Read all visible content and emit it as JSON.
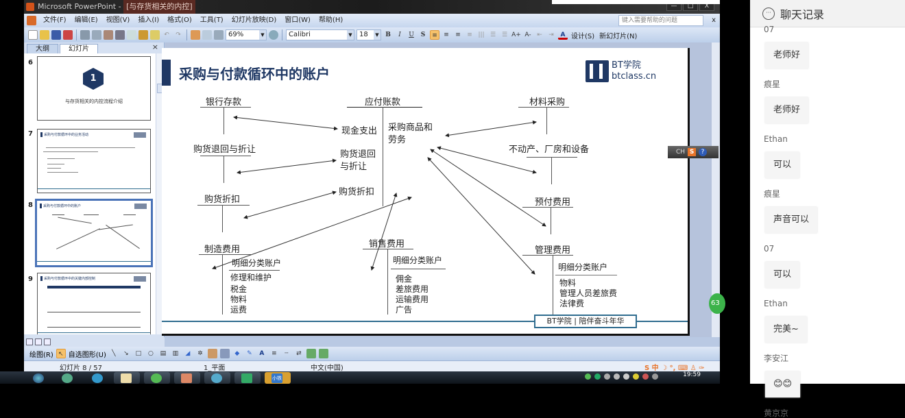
{
  "window": {
    "title_app": "Microsoft PowerPoint - ",
    "title_doc": "[与存货相关的内控]",
    "min": "—",
    "max": "□",
    "close": "X"
  },
  "menu": {
    "items": [
      "文件(F)",
      "编辑(E)",
      "视图(V)",
      "插入(I)",
      "格式(O)",
      "工具(T)",
      "幻灯片放映(D)",
      "窗口(W)",
      "帮助(H)"
    ],
    "help_placeholder": "键入需要帮助的问题",
    "close": "x"
  },
  "toolbar": {
    "zoom": "69%",
    "font": "Calibri",
    "font_size": "18",
    "bold": "B",
    "italic": "I",
    "underline": "U",
    "shadow": "S",
    "increase_font": "A+",
    "decrease_font": "A-",
    "font_color": "A",
    "design": "设计(S)",
    "new_slide": "新幻灯片(N)"
  },
  "left_panel": {
    "tabs": [
      "大纲",
      "幻灯片"
    ],
    "close": "×",
    "slides": [
      {
        "num": "6",
        "caption": "与存货相关的内控流程介绍",
        "badge": "1"
      },
      {
        "num": "7",
        "caption": "采购与付款循环中的业务活动"
      },
      {
        "num": "8",
        "caption": "采购与付款循环中的账户",
        "selected": true
      },
      {
        "num": "9",
        "caption": "采购与付款循环中的关键内部控制"
      }
    ]
  },
  "slide": {
    "title": "采购与付款循环中的账户",
    "logo_line1": "BT学院",
    "logo_line2": "btclass.cn",
    "accounts": {
      "bank": "银行存款",
      "payable": "应付账款",
      "material": "材料采购",
      "cash_out": "现金支出",
      "purchase_goods": "采购商品和\n劳务",
      "returns_left": "购货退回与折让",
      "returns_center": "购货退回\n与折让",
      "fixed_assets": "不动产、厂房和设备",
      "discount_left": "购货折扣",
      "discount_center": "购货折扣",
      "prepaid": "预付费用",
      "manufacturing": "制造费用",
      "selling": "销售费用",
      "admin": "管理费用",
      "detail_label": "明细分类账户",
      "mfg_details": [
        "修理和维护",
        "税金",
        "物料",
        "运费"
      ],
      "selling_details": [
        "佣金",
        "差旅费用",
        "运输费用",
        "广告"
      ],
      "admin_details": [
        "物料",
        "管理人员差旅费",
        "法律费"
      ]
    },
    "footer": "BT学院 | 陪伴奋斗年华"
  },
  "ime": {
    "lang": "CH",
    "s": "S",
    "help": "?"
  },
  "badge_63": "63",
  "drawbar": {
    "draw": "绘图(R)",
    "autoshape": "自选图形(U)"
  },
  "status": {
    "slide": "幻灯片 8 / 57",
    "design": "1_平面",
    "lang": "中文(中国)"
  },
  "taskbar": {
    "time": "19:59",
    "app_label": "小铁"
  },
  "chat": {
    "title": "聊天记录",
    "messages": [
      {
        "user": "07",
        "text": "老师好"
      },
      {
        "user": "痕星",
        "text": "老师好"
      },
      {
        "user": "Ethan",
        "text": "可以"
      },
      {
        "user": "痕星",
        "text": "声音可以"
      },
      {
        "user": "07",
        "text": "可以"
      },
      {
        "user": "Ethan",
        "text": "完美~"
      },
      {
        "user": "李安江",
        "text": "😊😊"
      },
      {
        "user": "黄京京",
        "text": ""
      }
    ]
  }
}
